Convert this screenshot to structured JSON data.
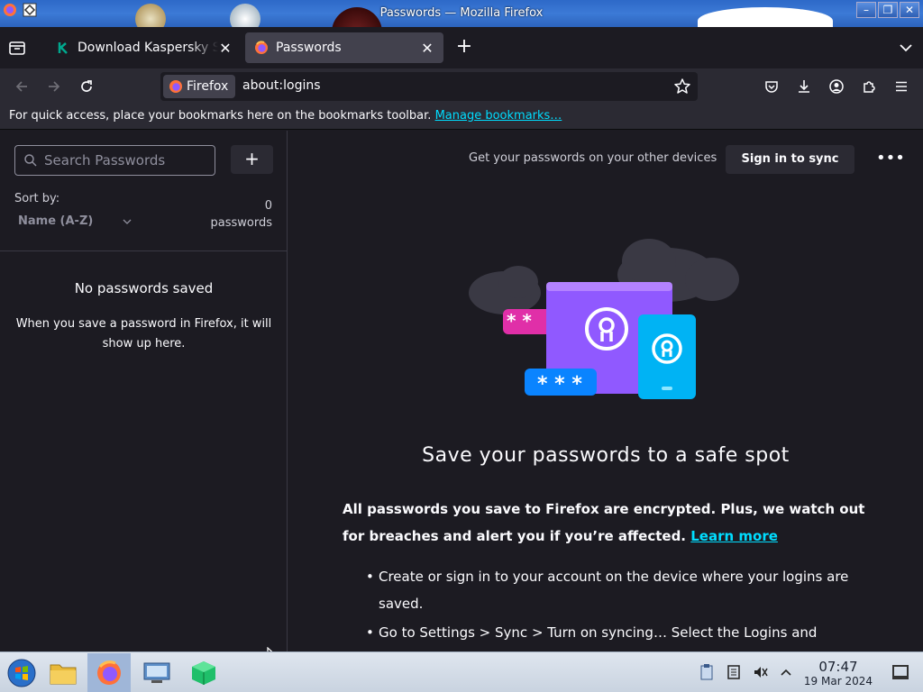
{
  "window": {
    "title": "Passwords — Mozilla Firefox"
  },
  "tabs": [
    {
      "label": "Download Kaspersky Standard",
      "favicon": "kaspersky-icon",
      "active": false
    },
    {
      "label": "Passwords",
      "favicon": "firefox-icon",
      "active": true
    }
  ],
  "urlbar": {
    "identity_label": "Firefox",
    "url": "about:logins"
  },
  "bookmarks_bar": {
    "message": "For quick access, place your bookmarks here on the bookmarks toolbar.",
    "link": "Manage bookmarks…"
  },
  "sidebar": {
    "search_placeholder": "Search Passwords",
    "add_label": "+",
    "sort_label": "Sort by:",
    "sort_value": "Name (A-Z)",
    "count": "0",
    "count_unit": "passwords",
    "empty_title": "No passwords saved",
    "empty_text": "When you save a password in Firefox, it will show up here."
  },
  "main": {
    "sync_message": "Get your passwords on your other devices",
    "sync_button": "Sign in to sync",
    "menu_label": "•••",
    "hero_title": "Save your passwords to a safe spot",
    "intro": "All passwords you save to Firefox are encrypted. Plus, we watch out for breaches and alert you if you’re affected.",
    "learn_more": "Learn more",
    "steps": [
      "Create or sign in to your account on the device where your logins are saved.",
      "Go to Settings > Sync > Turn on syncing… Select the Logins and"
    ]
  },
  "taskbar": {
    "time": "07:47",
    "date": "19 Mar 2024",
    "apps": [
      "start-menu",
      "file-manager",
      "firefox",
      "system-settings",
      "package-app"
    ]
  },
  "colors": {
    "accent_link": "#00ddff",
    "bg": "#1c1b22",
    "toolbar": "#2b2a33"
  }
}
